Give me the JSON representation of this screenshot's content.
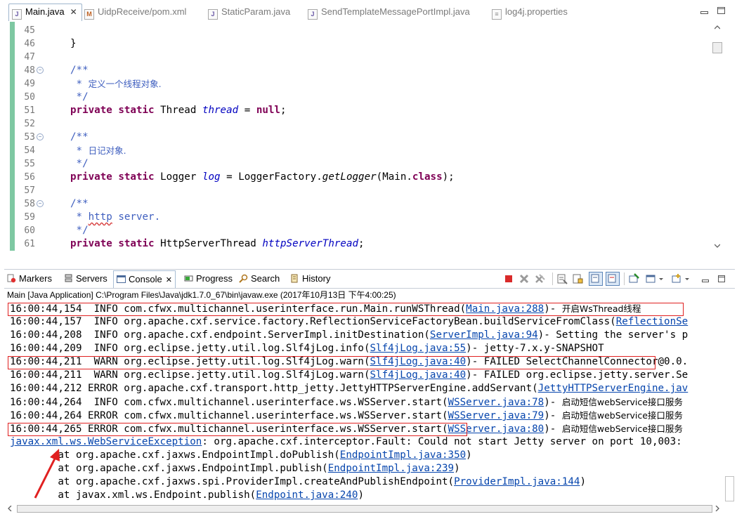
{
  "editor_tabs": [
    {
      "label": "Main.java",
      "active": true,
      "icon": "java-file-icon"
    },
    {
      "label": "UidpReceive/pom.xml",
      "active": false,
      "icon": "xml-file-icon"
    },
    {
      "label": "StaticParam.java",
      "active": false,
      "icon": "java-file-icon"
    },
    {
      "label": "SendTemplateMessagePortImpl.java",
      "active": false,
      "icon": "java-file-icon"
    },
    {
      "label": "log4j.properties",
      "active": false,
      "icon": "properties-file-icon"
    }
  ],
  "line_numbers": [
    "45",
    "46",
    "47",
    "48",
    "49",
    "50",
    "51",
    "52",
    "53",
    "54",
    "55",
    "56",
    "57",
    "58",
    "59",
    "60",
    "61"
  ],
  "code": {
    "l46_brace": "}",
    "c_open": "/**",
    "c_star": " * ",
    "c_close": " */",
    "thread_comment": "定义一个线程对象.",
    "log_comment": "日记对象.",
    "http_word": "http",
    "server_word": " server.",
    "kw_private": "private",
    "kw_static": "static",
    "kw_null": "null",
    "kw_class": "class",
    "type_thread": "Thread",
    "var_thread": "thread",
    "eq": " = ",
    "semi": ";",
    "type_logger": "Logger",
    "var_log": "log",
    "logger_factory": "LoggerFactory.",
    "get_logger": "getLogger",
    "main_arg": "(Main.",
    "close_paren_semi": ");",
    "type_http": "HttpServerThread",
    "var_http": "httpServerThread"
  },
  "view_tabs": [
    {
      "label": "Markers",
      "icon": "markers-icon"
    },
    {
      "label": "Servers",
      "icon": "servers-icon"
    },
    {
      "label": "Console",
      "icon": "console-icon",
      "active": true
    },
    {
      "label": "Progress",
      "icon": "progress-icon"
    },
    {
      "label": "Search",
      "icon": "search-icon"
    },
    {
      "label": "History",
      "icon": "history-icon"
    }
  ],
  "console_close": "✕",
  "console_title": "Main [Java Application] C:\\Program Files\\Java\\jdk1.7.0_67\\bin\\javaw.exe (2017年10月13日 下午4:00:25)",
  "console_lines": [
    {
      "pre": "16:00:44,154  INFO com.cfwx.multichannel.userinterface.run.Main.runWSThread(",
      "link": "Main.java:288",
      "post": ")- ",
      "cn": "开启WsThread线程"
    },
    {
      "pre": "16:00:44,157  INFO org.apache.cxf.service.factory.ReflectionServiceFactoryBean.buildServiceFromClass(",
      "link": "ReflectionSe",
      "post": "",
      "cn": ""
    },
    {
      "pre": "16:00:44,208  INFO org.apache.cxf.endpoint.ServerImpl.initDestination(",
      "link": "ServerImpl.java:94",
      "post": ")- Setting the server's p",
      "cn": ""
    },
    {
      "pre": "16:00:44,209  INFO org.eclipse.jetty.util.log.Slf4jLog.info(",
      "link": "Slf4jLog.java:55",
      "post": ")- jetty-7.x.y-SNAPSHOT",
      "cn": ""
    },
    {
      "pre": "16:00:44,211  WARN org.eclipse.jetty.util.log.Slf4jLog.warn(",
      "link": "Slf4jLog.java:40",
      "post": ")- FAILED SelectChannelConnector@0.0.",
      "cn": ""
    },
    {
      "pre": "16:00:44,211  WARN org.eclipse.jetty.util.log.Slf4jLog.warn(",
      "link": "Slf4jLog.java:40",
      "post": ")- FAILED org.eclipse.jetty.server.Se",
      "cn": ""
    },
    {
      "pre": "16:00:44,212 ERROR org.apache.cxf.transport.http_jetty.JettyHTTPServerEngine.addServant(",
      "link": "JettyHTTPServerEngine.jav",
      "post": "",
      "cn": ""
    },
    {
      "pre": "16:00:44,264  INFO com.cfwx.multichannel.userinterface.ws.WSServer.start(",
      "link": "WSServer.java:78",
      "post": ")- ",
      "cn": "启动短信webService接口服务"
    },
    {
      "pre": "16:00:44,264 ERROR com.cfwx.multichannel.userinterface.ws.WSServer.start(",
      "link": "WSServer.java:79",
      "post": ")- ",
      "cn": "启动短信webService接口服务"
    },
    {
      "pre": "16:00:44,265 ERROR com.cfwx.multichannel.userinterface.ws.WSServer.start(",
      "link": "WSServer.java:80",
      "post": ")- ",
      "cn": "启动短信webService接口服务"
    }
  ],
  "exception": {
    "link": "javax.xml.ws.WebServiceException",
    "text": ": org.apache.cxf.interceptor.Fault: Could not start Jetty server on port 10,003: "
  },
  "stack": [
    {
      "pre": "        at org.apache.cxf.jaxws.EndpointImpl.doPublish(",
      "link": "EndpointImpl.java:350",
      "post": ")"
    },
    {
      "pre": "        at org.apache.cxf.jaxws.EndpointImpl.publish(",
      "link": "EndpointImpl.java:239",
      "post": ")"
    },
    {
      "pre": "        at org.apache.cxf.jaxws.spi.ProviderImpl.createAndPublishEndpoint(",
      "link": "ProviderImpl.java:144",
      "post": ")"
    },
    {
      "pre": "        at javax.xml.ws.Endpoint.publish(",
      "link": "Endpoint.java:240",
      "post": ")"
    }
  ],
  "colors": {
    "keyword": "#7f0055",
    "comment": "#3f5fbf",
    "field": "#0000c0",
    "link": "#0645ad",
    "highlight": "#e02020"
  }
}
